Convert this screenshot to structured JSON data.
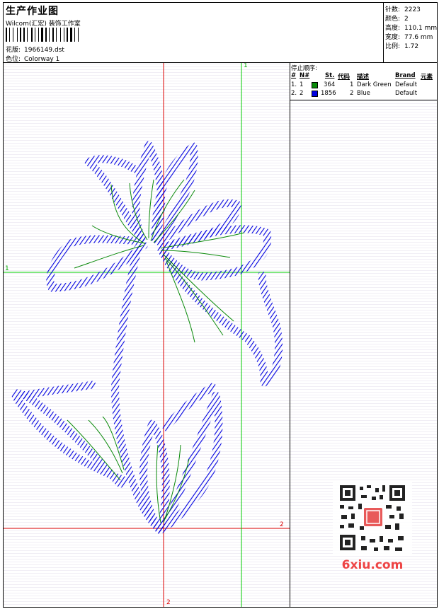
{
  "header": {
    "title": "生产作业图",
    "company": "Wilcom(汇宏) 装饰工作室",
    "design_label": "花版:",
    "design_value": "1966149.dst",
    "colorway_label": "色位:",
    "colorway_value": "Colorway 1"
  },
  "stats": {
    "stitches_label": "针数:",
    "stitches_value": "2223",
    "colors_label": "颜色:",
    "colors_value": "2",
    "height_label": "高度:",
    "height_value": "110.1 mm",
    "width_label": "宽度:",
    "width_value": "77.6 mm",
    "scale_label": "比例:",
    "scale_value": "1.72"
  },
  "stop_sequence": {
    "title": "停止顺序:",
    "columns": [
      "#",
      "N#",
      "St.",
      "代码",
      "描述",
      "Brand",
      "元素"
    ],
    "rows": [
      {
        "index": "1.",
        "n": "1",
        "stitches": "364",
        "code": "1",
        "description": "Dark Green",
        "brand": "Default",
        "color": "#0a8a0a"
      },
      {
        "index": "2.",
        "n": "2",
        "stitches": "1856",
        "code": "2",
        "description": "Blue",
        "brand": "Default",
        "color": "#0000e0"
      }
    ]
  },
  "guides": {
    "top_label": "1",
    "left_label": "1",
    "right_label": "2",
    "bottom_label": "2",
    "red_color": "#dd0000",
    "green_color": "#00cc00"
  },
  "colors": {
    "thread_blue": "#0000e0",
    "thread_green": "#0a8a0a"
  },
  "watermark": {
    "site": "6xiu.com",
    "qr_icon": "qr-code-icon"
  }
}
